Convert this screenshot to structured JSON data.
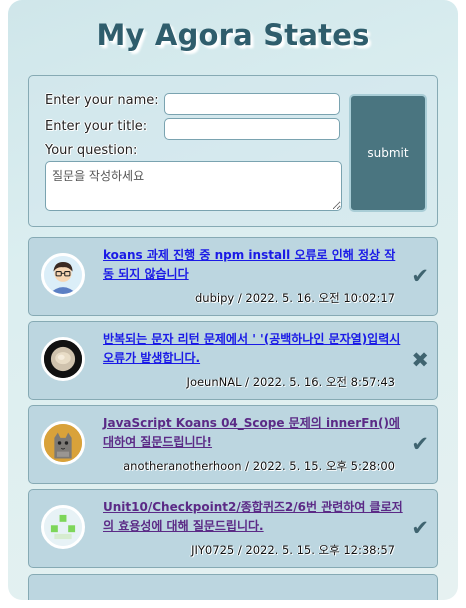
{
  "app": {
    "title": "My Agora States"
  },
  "form": {
    "name_label": "Enter your name:",
    "title_label": "Enter your title:",
    "question_label": "Your question:",
    "name_value": "",
    "title_value": "",
    "question_placeholder": "질문을 작성하세요",
    "submit_label": "submit"
  },
  "discussions": [
    {
      "title": "koans 과제 진행 중 npm install 오류로 인해 정상 작동 되지 않습니다",
      "meta": "dubipy / 2022. 5. 16. 오전 10:02:17",
      "status": "✔",
      "answered": true,
      "avatar_icon": "boy-with-glasses-avatar"
    },
    {
      "title": "반복되는 문자 리턴 문제에서 ' '(공백하나인 문자열)입력시 오류가 발생합니다.",
      "meta": "JoeunNAL / 2022. 5. 16. 오전 8:57:43",
      "status": "✖",
      "answered": false,
      "avatar_icon": "food-photo-avatar"
    },
    {
      "title": "JavaScript Koans 04_Scope 문제의 innerFn()에 대하여 질문드립니다!",
      "meta": "anotheranotherhoon / 2022. 5. 15. 오후 5:28:00",
      "status": "✔",
      "answered": true,
      "avatar_icon": "cat-avatar"
    },
    {
      "title": "Unit10/Checkpoint2/종합퀴즈2/6번 관련하여 클로저의 효용성에 대해 질문드립니다.",
      "meta": "JIY0725 / 2022. 5. 15. 오후 12:38:57",
      "status": "✔",
      "answered": true,
      "avatar_icon": "green-blob-avatar"
    }
  ],
  "colors": {
    "title": "#2f5d6c",
    "submit_bg": "#4a7580",
    "card_bg": "#bcd6e0",
    "link": "#1a1ae6",
    "visited_link": "#5b2a86"
  }
}
